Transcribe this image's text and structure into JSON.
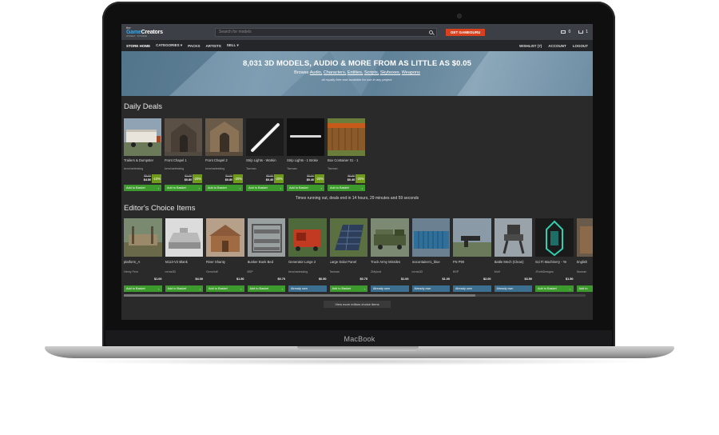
{
  "device_label": "MacBook",
  "header": {
    "logo_small": "the",
    "logo_part1": "Game",
    "logo_part2": "Creators",
    "logo_sub": "ASSET STORE",
    "search_placeholder": "Search for models",
    "cta_label": "GET GAMEGURU",
    "mail_count": "0",
    "cart_count": "1"
  },
  "nav": {
    "items": [
      "STORE HOME",
      "CATEGORIES ▾",
      "PACKS",
      "ARTISTS",
      "SELL ▾"
    ],
    "right": [
      "WISHLIST (7)",
      "ACCOUNT",
      "LOGOUT"
    ]
  },
  "hero": {
    "title": "8,031 3D MODELS, AUDIO & MORE FROM AS LITTLE AS $0.05",
    "browse_prefix": "Browse",
    "links": [
      "Audio,",
      "Characters,",
      "Entities,",
      "Scripts,",
      "Skyboxes,",
      "Weapons"
    ],
    "note": "all royalty free and available for use in any project."
  },
  "daily_deals": {
    "title": "Daily Deals",
    "items": [
      {
        "name": "Trailers & Dumpster",
        "author": "kenchartesking",
        "old_price": "$5.00",
        "new_price": "$4.50",
        "discount": "-10%",
        "button": "Add to Basket"
      },
      {
        "name": "Front Chapel 1",
        "author": "kenchartesking",
        "old_price": "$1.00",
        "new_price": "$0.80",
        "discount": "-20%",
        "button": "Add to Basket"
      },
      {
        "name": "Front Chapel 2",
        "author": "kenchartesking",
        "old_price": "$1.00",
        "new_price": "$0.80",
        "discount": "-20%",
        "button": "Add to Basket"
      },
      {
        "name": "Strip Lights - Workin",
        "author": "Taxman",
        "old_price": "$0.50",
        "new_price": "$0.40",
        "discount": "-20%",
        "button": "Add to Basket"
      },
      {
        "name": "Strip Lights - 1 Broke",
        "author": "Taxman",
        "old_price": "$0.50",
        "new_price": "$0.40",
        "discount": "-20%",
        "button": "Add to Basket"
      },
      {
        "name": "Box Container 01 - 1",
        "author": "Taxman",
        "old_price": "$0.50",
        "new_price": "$0.40",
        "discount": "-20%",
        "button": "Add to Basket"
      }
    ],
    "timer": "Times running out, deals end in 14 hours, 29 minutes and 59 seconds"
  },
  "editors_choice": {
    "title": "Editor's Choice Items",
    "items": [
      {
        "name": "platform_A",
        "author": "Henry Fern",
        "price": "$1.00",
        "button": "Add to Basket",
        "owned": false
      },
      {
        "name": "M113-V2 Blank",
        "author": "mrms3D",
        "price": "$4.00",
        "button": "Add to Basket",
        "owned": false
      },
      {
        "name": "River Shanty",
        "author": "Genchoff",
        "price": "$1.50",
        "button": "Add to Basket",
        "owned": false
      },
      {
        "name": "Bunker Bunk Bed",
        "author": "BSP",
        "price": "$0.70",
        "button": "Add to Basket",
        "owned": false
      },
      {
        "name": "Generator Large 2",
        "author": "kenchartesking",
        "price": "$0.50",
        "button": "Already own",
        "owned": true
      },
      {
        "name": "Large Solar Panel",
        "author": "Taxman",
        "price": "$0.75",
        "button": "Add to Basket",
        "owned": false
      },
      {
        "name": "Truck Army Missiles",
        "author": "ZMylord",
        "price": "$1.00",
        "button": "Already own",
        "owned": true
      },
      {
        "name": "isocontainer1_blue",
        "author": "mrms3D",
        "price": "$1.00",
        "button": "Already own",
        "owned": true
      },
      {
        "name": "FN P90",
        "author": "BSP",
        "price": "$2.00",
        "button": "Already own",
        "owned": true
      },
      {
        "name": "Battle Mech (Clean)",
        "author": "Wolf",
        "price": "$3.50",
        "button": "Already own",
        "owned": true
      },
      {
        "name": "Sci Fi Machinery - Ye",
        "author": "JTorthDesigns",
        "price": "$1.50",
        "button": "Add to Basket",
        "owned": false
      },
      {
        "name": "English",
        "author": "Taxman",
        "price": "",
        "button": "Add to",
        "owned": false
      }
    ],
    "more_label": "View more editors choice items"
  },
  "colors": {
    "accent_green": "#3d9a2d",
    "discount_green": "#6f9a1b",
    "owned_blue": "#3c6f8f",
    "cta_orange": "#d9411e",
    "logo_blue": "#3aa6e8"
  }
}
